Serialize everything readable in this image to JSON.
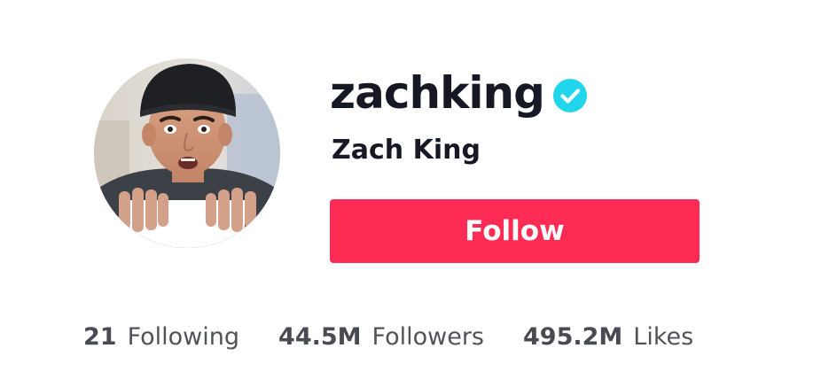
{
  "profile": {
    "username": "zachking",
    "display_name": "Zach King",
    "verified": true,
    "avatar_icon": "profile-photo",
    "verified_icon": "verified-badge-icon"
  },
  "actions": {
    "follow_label": "Follow"
  },
  "stats": [
    {
      "count": "21",
      "label": "Following"
    },
    {
      "count": "44.5M",
      "label": "Followers"
    },
    {
      "count": "495.2M",
      "label": "Likes"
    }
  ],
  "colors": {
    "follow_button": "#fe2c55",
    "verified_badge": "#20d5ec",
    "text_primary": "#161823"
  }
}
